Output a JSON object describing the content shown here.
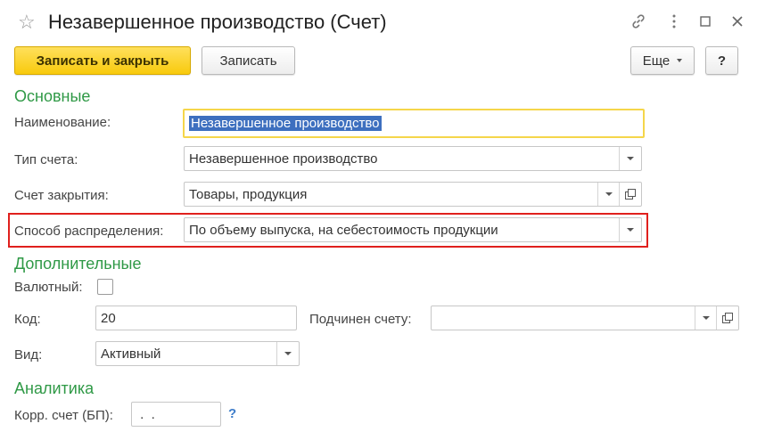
{
  "window": {
    "title": "Незавершенное производство (Счет)"
  },
  "toolbar": {
    "save_close_label": "Записать и закрыть",
    "save_label": "Записать",
    "more_label": "Еще",
    "help_label": "?"
  },
  "sections": {
    "main": "Основные",
    "extra": "Дополнительные",
    "analytics": "Аналитика"
  },
  "fields": {
    "name": {
      "label": "Наименование:",
      "value": "Незавершенное производство"
    },
    "type": {
      "label": "Тип счета:",
      "value": "Незавершенное производство"
    },
    "closing": {
      "label": "Счет закрытия:",
      "value": "Товары, продукция"
    },
    "distribution": {
      "label": "Способ распределения:",
      "value": "По объему выпуска, на себестоимость продукции"
    },
    "currency": {
      "label": "Валютный:",
      "checked": false
    },
    "code": {
      "label": "Код:",
      "value": "20"
    },
    "parent": {
      "label": "Подчинен счету:",
      "value": ""
    },
    "kind": {
      "label": "Вид:",
      "value": "Активный"
    },
    "corr": {
      "label": "Корр. счет (БП):",
      "value": " .  ."
    },
    "corr_help": "?"
  },
  "colors": {
    "accent_green": "#2f9946",
    "highlight_red": "#e0201d",
    "primary_yellow": "#f8ca0d"
  },
  "icons": [
    "star-icon",
    "link-icon",
    "more-vertical-icon",
    "maximize-icon",
    "close-icon",
    "dropdown-arrow-icon",
    "open-form-icon"
  ]
}
